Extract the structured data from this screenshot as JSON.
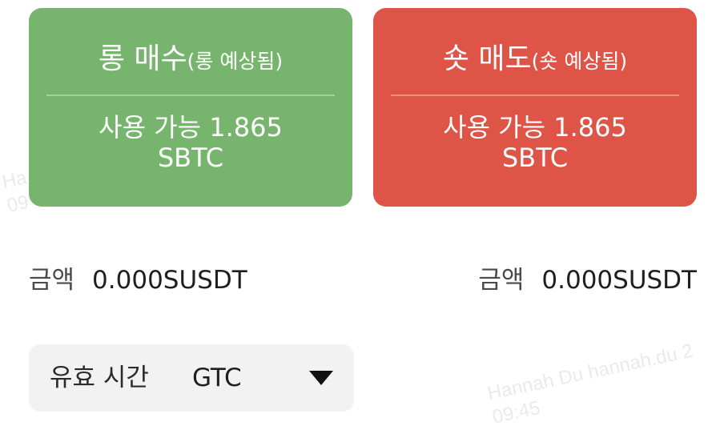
{
  "long_button": {
    "title": "롱 매수",
    "subtitle": "(롱 예상됨)",
    "available": "사용 가능 1.865",
    "unit": "SBTC",
    "color": "#77b56e"
  },
  "short_button": {
    "title": "숏 매도",
    "subtitle": "(숏 예상됨)",
    "available": "사용 가능 1.865",
    "unit": "SBTC",
    "color": "#de5446"
  },
  "long_amount": {
    "label": "금액",
    "value": "0.000SUSDT"
  },
  "short_amount": {
    "label": "금액",
    "value": "0.000SUSDT"
  },
  "validity": {
    "label": "유효 시간",
    "value": "GTC"
  },
  "watermarks": [
    {
      "line1": "Hannah Du hannah.du 2",
      "line2": "09:45"
    },
    {
      "line1": "Ha",
      "line2": "09"
    }
  ]
}
